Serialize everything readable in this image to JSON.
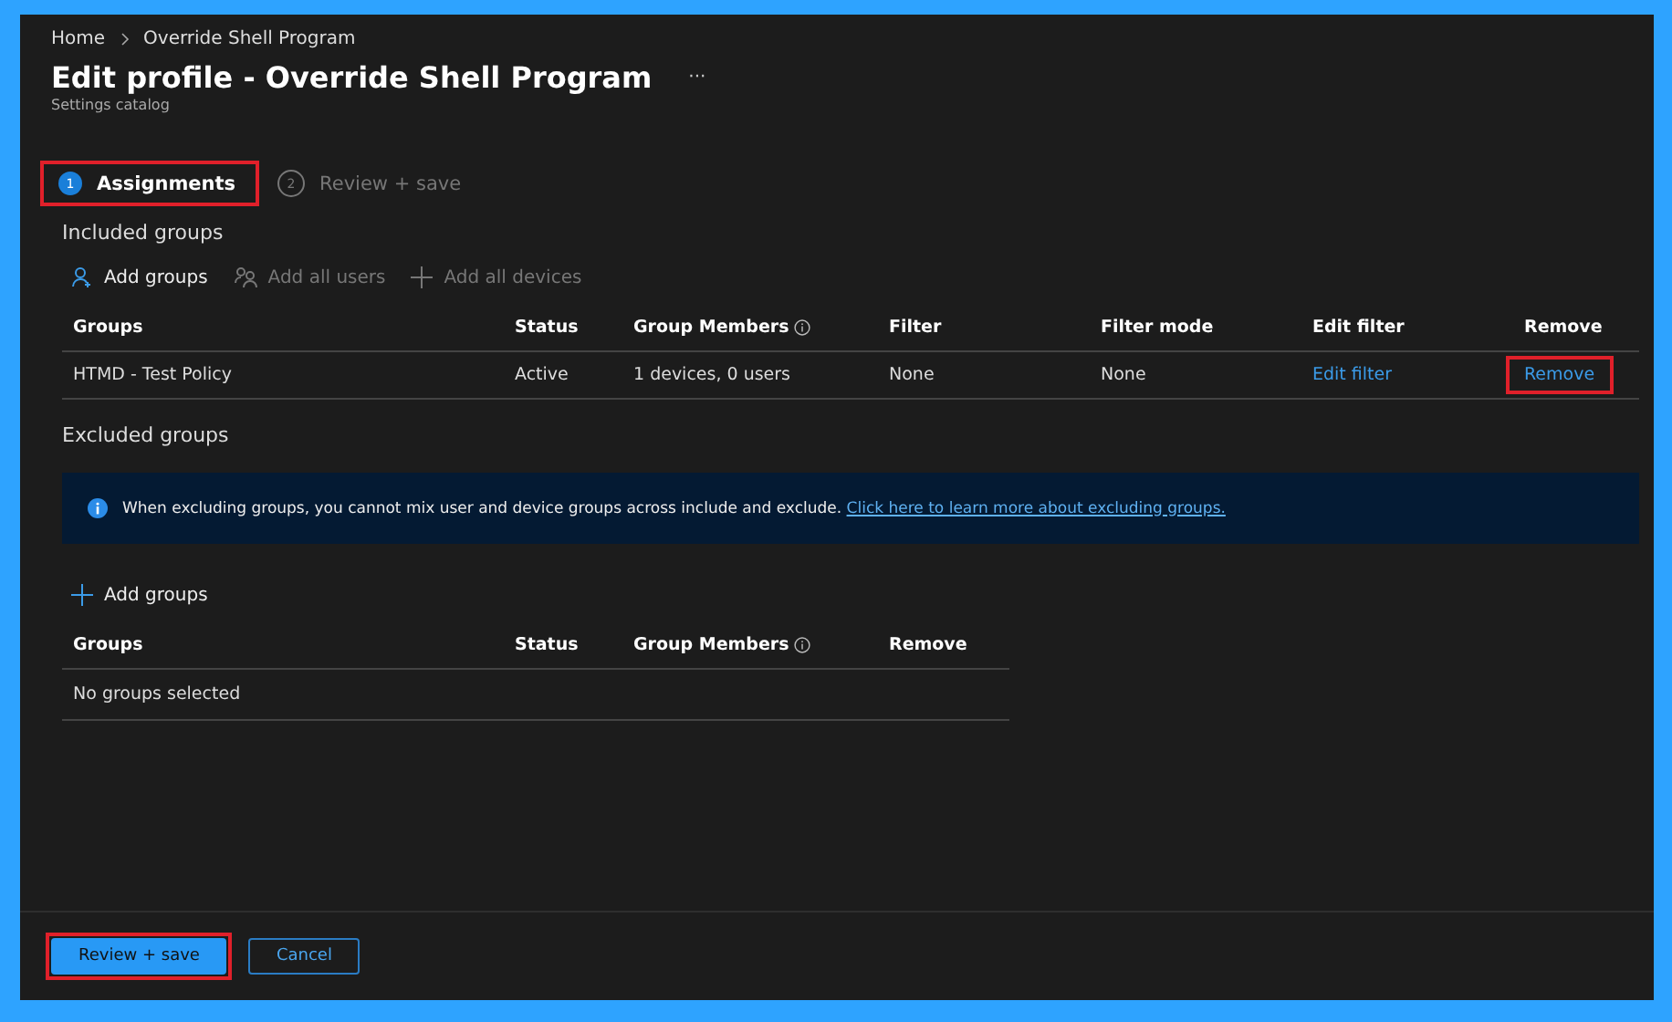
{
  "breadcrumb": [
    {
      "label": "Home"
    },
    {
      "label": "Override Shell Program"
    }
  ],
  "title": "Edit profile - Override Shell Program",
  "more": "···",
  "subtitle": "Settings catalog",
  "steps": [
    {
      "number": "1",
      "label": "Assignments",
      "selected": true,
      "highlighted": true
    },
    {
      "number": "2",
      "label": "Review + save",
      "selected": false,
      "highlighted": false
    }
  ],
  "included": {
    "heading": "Included groups",
    "toolbar": [
      {
        "kind": "person",
        "label": "Add groups",
        "disabled": false
      },
      {
        "kind": "people",
        "label": "Add all users",
        "disabled": true
      },
      {
        "kind": "plus",
        "label": "Add all devices",
        "disabled": true
      }
    ],
    "columns": [
      {
        "label": "Groups",
        "info": false
      },
      {
        "label": "Status",
        "info": false
      },
      {
        "label": "Group Members",
        "info": true
      },
      {
        "label": "Filter",
        "info": false
      },
      {
        "label": "Filter mode",
        "info": false
      },
      {
        "label": "Edit filter",
        "info": false
      },
      {
        "label": "Remove",
        "info": false
      }
    ],
    "rows": [
      [
        {
          "text": "HTMD - Test Policy",
          "kind": "text",
          "highlighted": false
        },
        {
          "text": "Active",
          "kind": "text",
          "highlighted": false
        },
        {
          "text": "1 devices, 0 users",
          "kind": "text",
          "highlighted": false
        },
        {
          "text": "None",
          "kind": "text",
          "highlighted": false
        },
        {
          "text": "None",
          "kind": "text",
          "highlighted": false
        },
        {
          "text": "Edit filter",
          "kind": "link",
          "highlighted": false
        },
        {
          "text": "Remove",
          "kind": "link",
          "highlighted": true
        }
      ]
    ]
  },
  "excluded": {
    "heading": "Excluded groups",
    "info": {
      "text": "When excluding groups, you cannot mix user and device groups across include and exclude.",
      "link": "Click here to learn more about excluding groups."
    },
    "toolbar": [
      {
        "kind": "plus",
        "label": "Add groups",
        "disabled": false
      }
    ],
    "columns": [
      {
        "label": "Groups",
        "info": false
      },
      {
        "label": "Status",
        "info": false
      },
      {
        "label": "Group Members",
        "info": true
      },
      {
        "label": "Remove",
        "info": false
      }
    ],
    "empty": "No groups selected"
  },
  "footer": [
    {
      "label": "Review + save",
      "kind": "primary",
      "highlighted": true
    },
    {
      "label": "Cancel",
      "kind": "secondary",
      "highlighted": false
    }
  ]
}
